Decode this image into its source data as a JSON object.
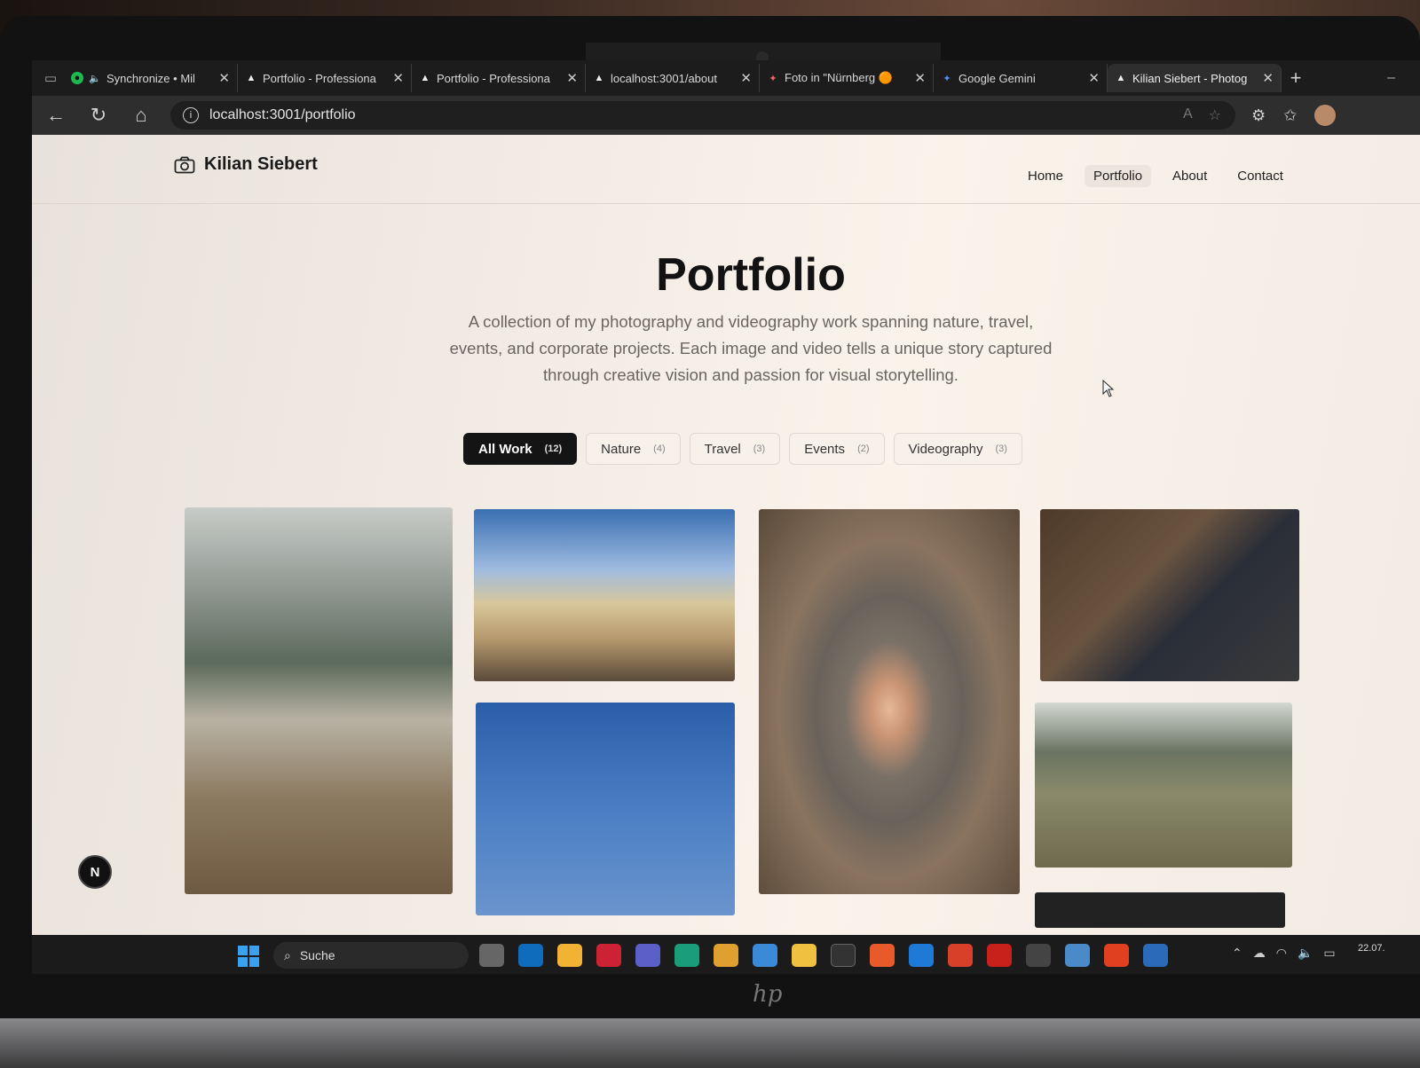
{
  "browser": {
    "tabs": [
      {
        "title": "Synchronize • Mil",
        "icon": "spotify-icon"
      },
      {
        "title": "Portfolio - Professiona",
        "icon": "triangle-icon"
      },
      {
        "title": "Portfolio - Professiona",
        "icon": "triangle-icon"
      },
      {
        "title": "localhost:3001/about",
        "icon": "triangle-icon"
      },
      {
        "title": "Foto in \"Nürnberg 🟠",
        "icon": "photos-icon"
      },
      {
        "title": "Google Gemini",
        "icon": "gemini-icon"
      },
      {
        "title": "Kilian Siebert - Photog",
        "icon": "triangle-icon",
        "active": true
      }
    ],
    "url": "localhost:3001/portfolio"
  },
  "site": {
    "brand": "Kilian Siebert",
    "nav": [
      "Home",
      "Portfolio",
      "About",
      "Contact"
    ],
    "active_nav": "Portfolio"
  },
  "page": {
    "title": "Portfolio",
    "intro": "A collection of my photography and videography work spanning nature, travel, events, and corporate projects. Each image and video tells a unique story captured through creative vision and passion for visual storytelling.",
    "filters": [
      {
        "label": "All Work",
        "count": "(12)",
        "active": true
      },
      {
        "label": "Nature",
        "count": "(4)"
      },
      {
        "label": "Travel",
        "count": "(3)"
      },
      {
        "label": "Events",
        "count": "(2)"
      },
      {
        "label": "Videography",
        "count": "(3)"
      }
    ],
    "dev_badge": "N"
  },
  "taskbar": {
    "search_placeholder": "Suche",
    "clock_date": "22.07."
  }
}
